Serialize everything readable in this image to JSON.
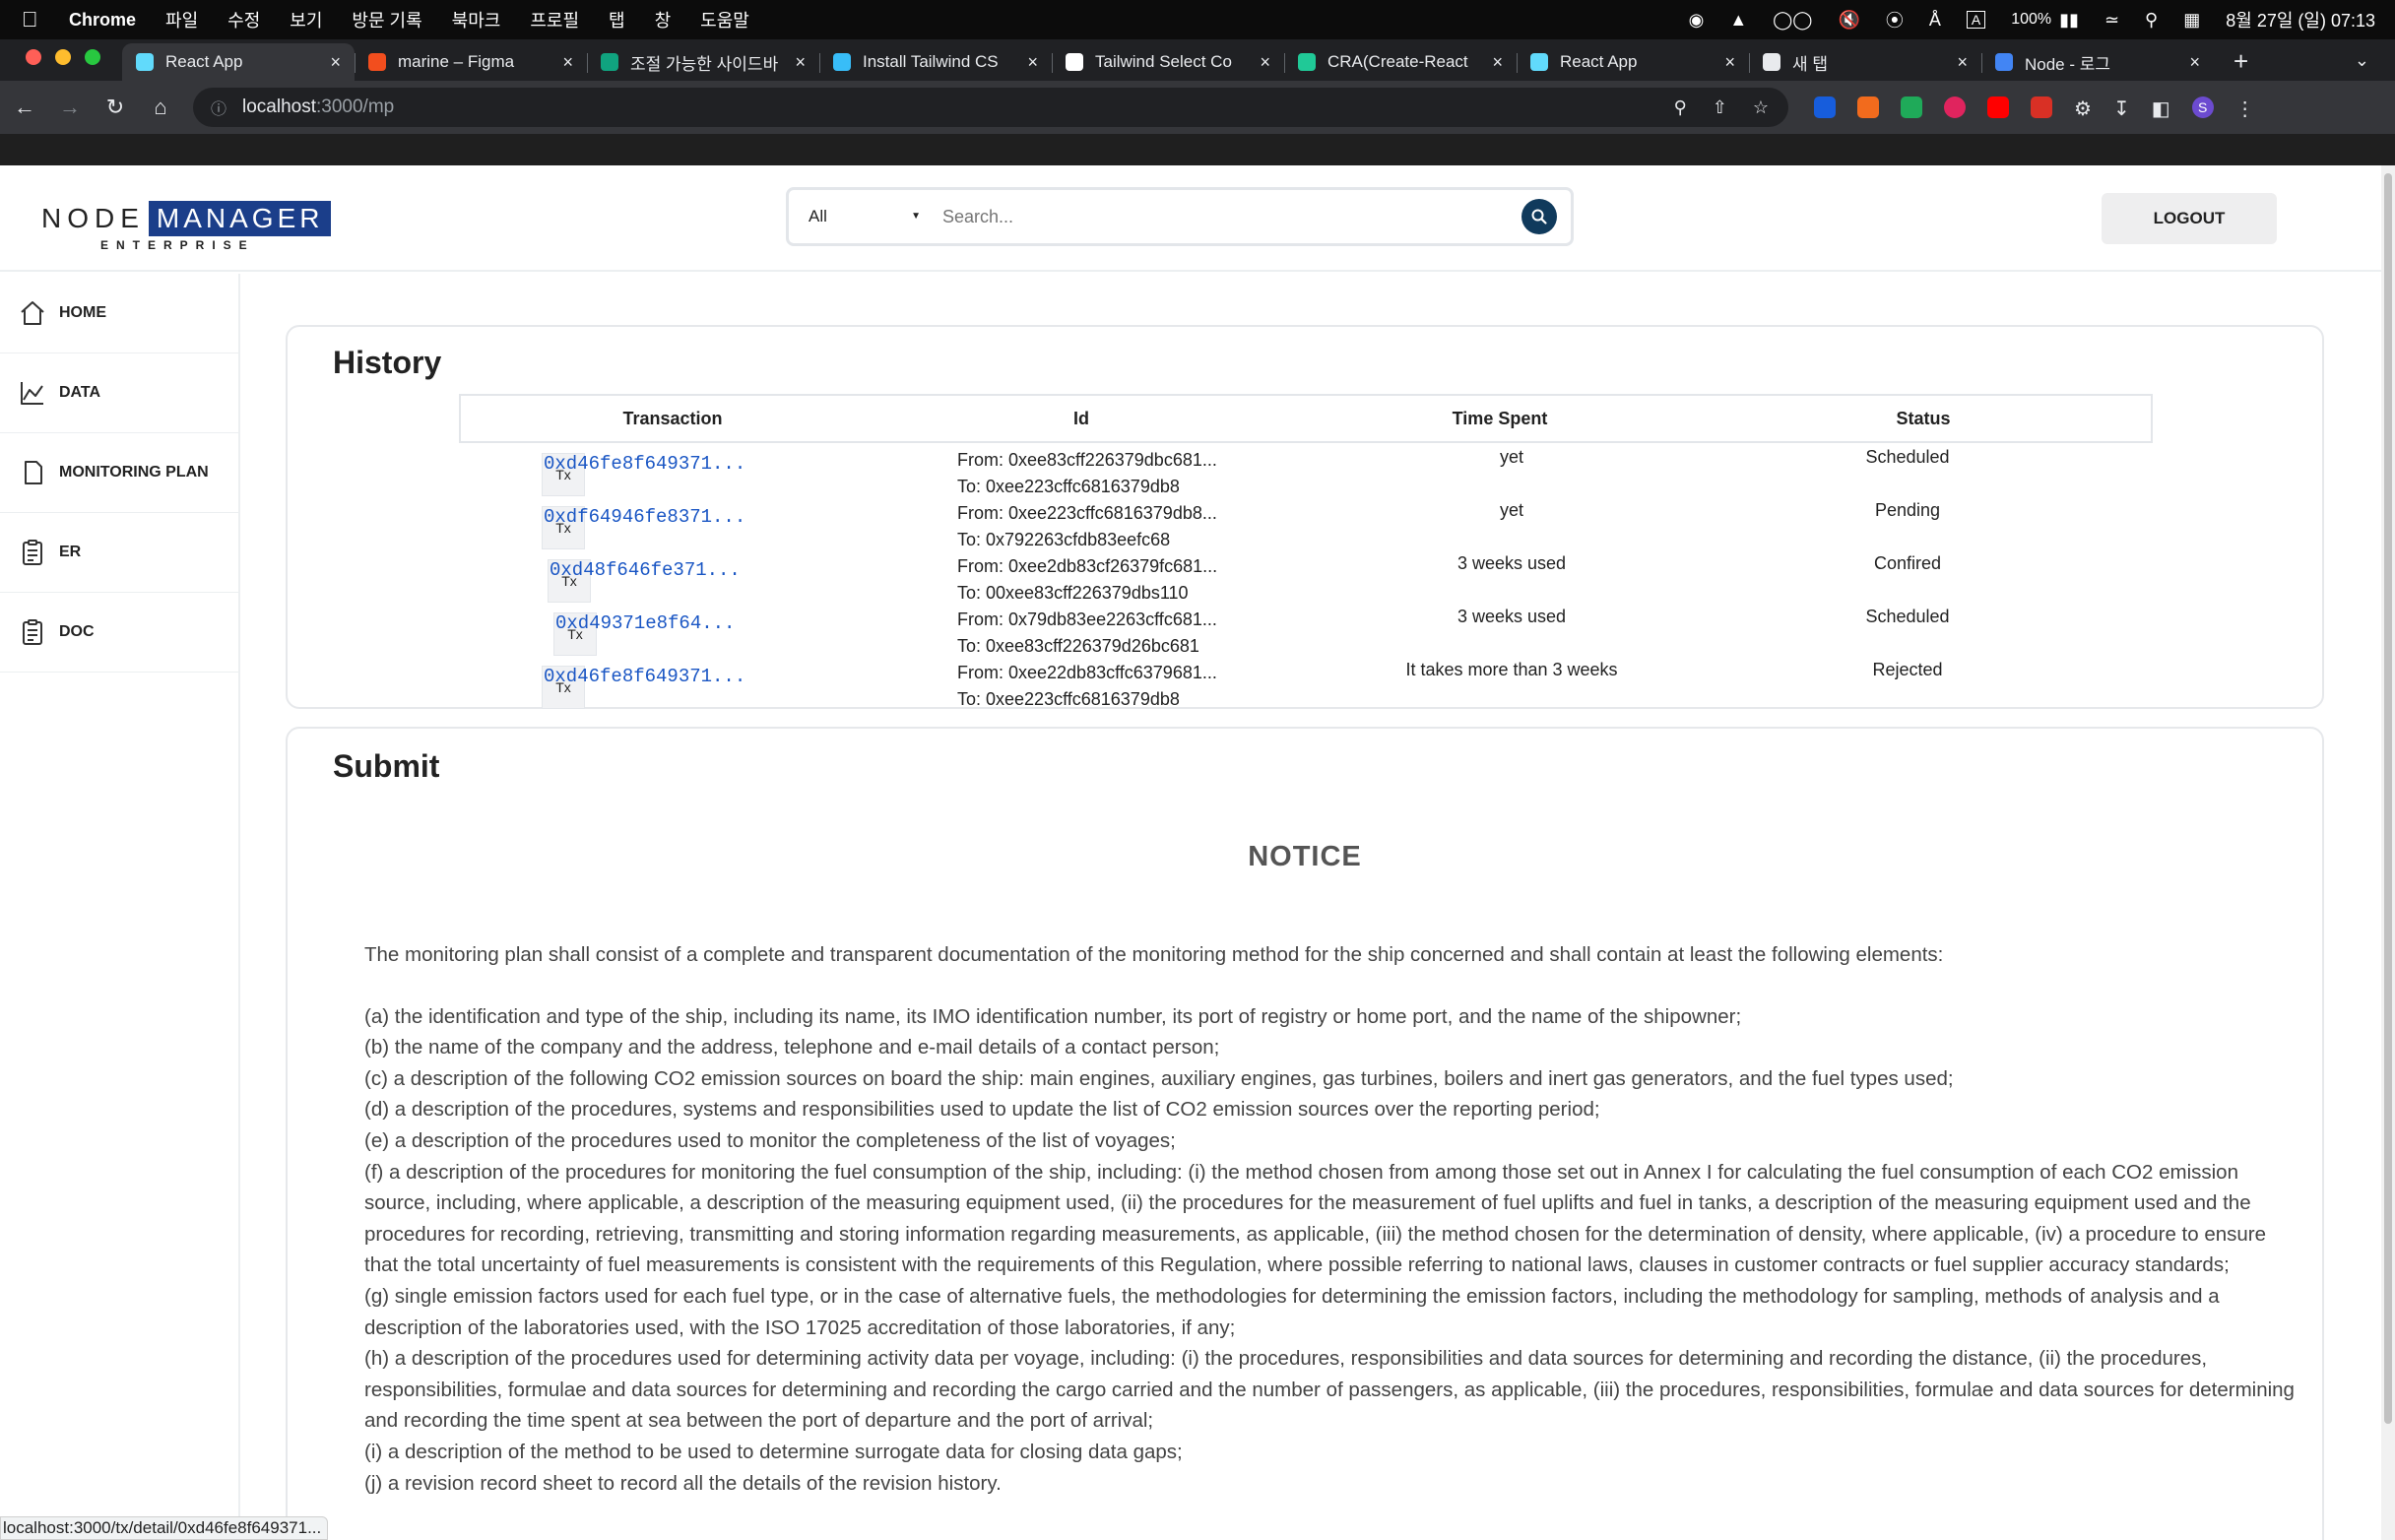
{
  "menubar": {
    "app": "Chrome",
    "items": [
      "파일",
      "수정",
      "보기",
      "방문 기록",
      "북마크",
      "프로필",
      "탭",
      "창",
      "도움말"
    ],
    "battery": "100%",
    "datetime": "8월 27일 (일) 07:13",
    "input_indicator": "A"
  },
  "tabs": [
    {
      "label": "React App",
      "active": true,
      "color": "#61dafb"
    },
    {
      "label": "marine – Figma",
      "active": false,
      "color": "#f24e1e"
    },
    {
      "label": "조절 가능한 사이드바",
      "active": false,
      "color": "#10a37f"
    },
    {
      "label": "Install Tailwind CS",
      "active": false,
      "color": "#38bdf8"
    },
    {
      "label": "Tailwind Select Co",
      "active": false,
      "color": "#ffffff"
    },
    {
      "label": "CRA(Create-React",
      "active": false,
      "color": "#20c997"
    },
    {
      "label": "React App",
      "active": false,
      "color": "#61dafb"
    },
    {
      "label": "새 탭",
      "active": false,
      "color": "#e8eaed"
    },
    {
      "label": "Node - 로그",
      "active": false,
      "color": "#4285f4"
    }
  ],
  "address": {
    "host": "localhost",
    "path": ":3000/mp"
  },
  "header": {
    "logo_node": "NODE",
    "logo_manager": "MANAGER",
    "logo_enterprise": "ENTERPRISE",
    "search_select": "All",
    "search_placeholder": "Search...",
    "logout": "LOGOUT"
  },
  "sidebar": {
    "items": [
      {
        "label": "HOME",
        "icon": "home-icon"
      },
      {
        "label": "DATA",
        "icon": "chart-icon"
      },
      {
        "label": "MONITORING PLAN",
        "icon": "document-icon"
      },
      {
        "label": "ER",
        "icon": "clipboard-icon"
      },
      {
        "label": "DOC",
        "icon": "clipboard-icon"
      }
    ]
  },
  "history": {
    "title": "History",
    "columns": [
      "Transaction",
      "Id",
      "Time Spent",
      "Status"
    ],
    "rows": [
      {
        "badge": "Tx",
        "hash": "0xd46fe8f649371...",
        "from": "From: 0xee83cff226379dbc681...",
        "to": "To: 0xee223cffc6816379db8",
        "time": "yet",
        "status": "Scheduled"
      },
      {
        "badge": "Tx",
        "hash": "0xdf64946fe8371...",
        "from": "From: 0xee223cffc6816379db8...",
        "to": "To: 0x792263cfdb83eefc68",
        "time": "yet",
        "status": "Pending"
      },
      {
        "badge": "Tx",
        "hash": "0xd48f646fe371...",
        "from": "From: 0xee2db83cf26379fc681...",
        "to": "To: 00xee83cff226379dbs110",
        "time": "3 weeks used",
        "status": "Confired"
      },
      {
        "badge": "Tx",
        "hash": "0xd49371e8f64...",
        "from": "From: 0x79db83ee2263cffc681...",
        "to": "To: 0xee83cff226379d26bc681",
        "time": "3 weeks used",
        "status": "Scheduled"
      },
      {
        "badge": "Tx",
        "hash": "0xd46fe8f649371...",
        "from": "From: 0xee22db83cffc6379681...",
        "to": "To: 0xee223cffc6816379db8",
        "time": "It takes more than 3 weeks",
        "status": "Rejected"
      }
    ]
  },
  "submit": {
    "title": "Submit",
    "notice_title": "NOTICE",
    "intro": "The monitoring plan shall consist of a complete and transparent documentation of the monitoring method for the ship concerned and shall contain at least the following elements:",
    "items": [
      "(a) the identification and type of the ship, including its name, its IMO identification number, its port of registry or home port, and the name of the shipowner;",
      "(b) the name of the company and the address, telephone and e-mail details of a contact person;",
      "(c) a description of the following CO2 emission sources on board the ship: main engines, auxiliary engines, gas turbines, boilers and inert gas generators, and the fuel types used;",
      "(d) a description of the procedures, systems and responsibilities used to update the list of CO2 emission sources over the reporting period;",
      "(e) a description of the procedures used to monitor the completeness of the list of voyages;",
      "(f) a description of the procedures for monitoring the fuel consumption of the ship, including: (i) the method chosen from among those set out in Annex I for calculating the fuel consumption of each CO2 emission source, including, where applicable, a description of the measuring equipment used, (ii) the procedures for the measurement of fuel uplifts and fuel in tanks, a description of the measuring equipment used and the procedures for recording, retrieving, transmitting and storing information regarding measurements, as applicable, (iii) the method chosen for the determination of density, where applicable, (iv) a procedure to ensure that the total uncertainty of fuel measurements is consistent with the requirements of this Regulation, where possible referring to national laws, clauses in customer contracts or fuel supplier accuracy standards;",
      "(g) single emission factors used for each fuel type, or in the case of alternative fuels, the methodologies for determining the emission factors, including the methodology for sampling, methods of analysis and a description of the laboratories used, with the ISO 17025 accreditation of those laboratories, if any;",
      "(h) a description of the procedures used for determining activity data per voyage, including: (i) the procedures, responsibilities and data sources for determining and recording the distance, (ii) the procedures, responsibilities, formulae and data sources for determining and recording the cargo carried and the number of passengers, as applicable, (iii) the procedures, responsibilities, formulae and data sources for determining and recording the time spent at sea between the port of departure and the port of arrival;",
      "(i) a description of the method to be used to determine surrogate data for closing data gaps;",
      "(j) a revision record sheet to record all the details of the revision history."
    ]
  },
  "status_url": "localhost:3000/tx/detail/0xd46fe8f649371..."
}
